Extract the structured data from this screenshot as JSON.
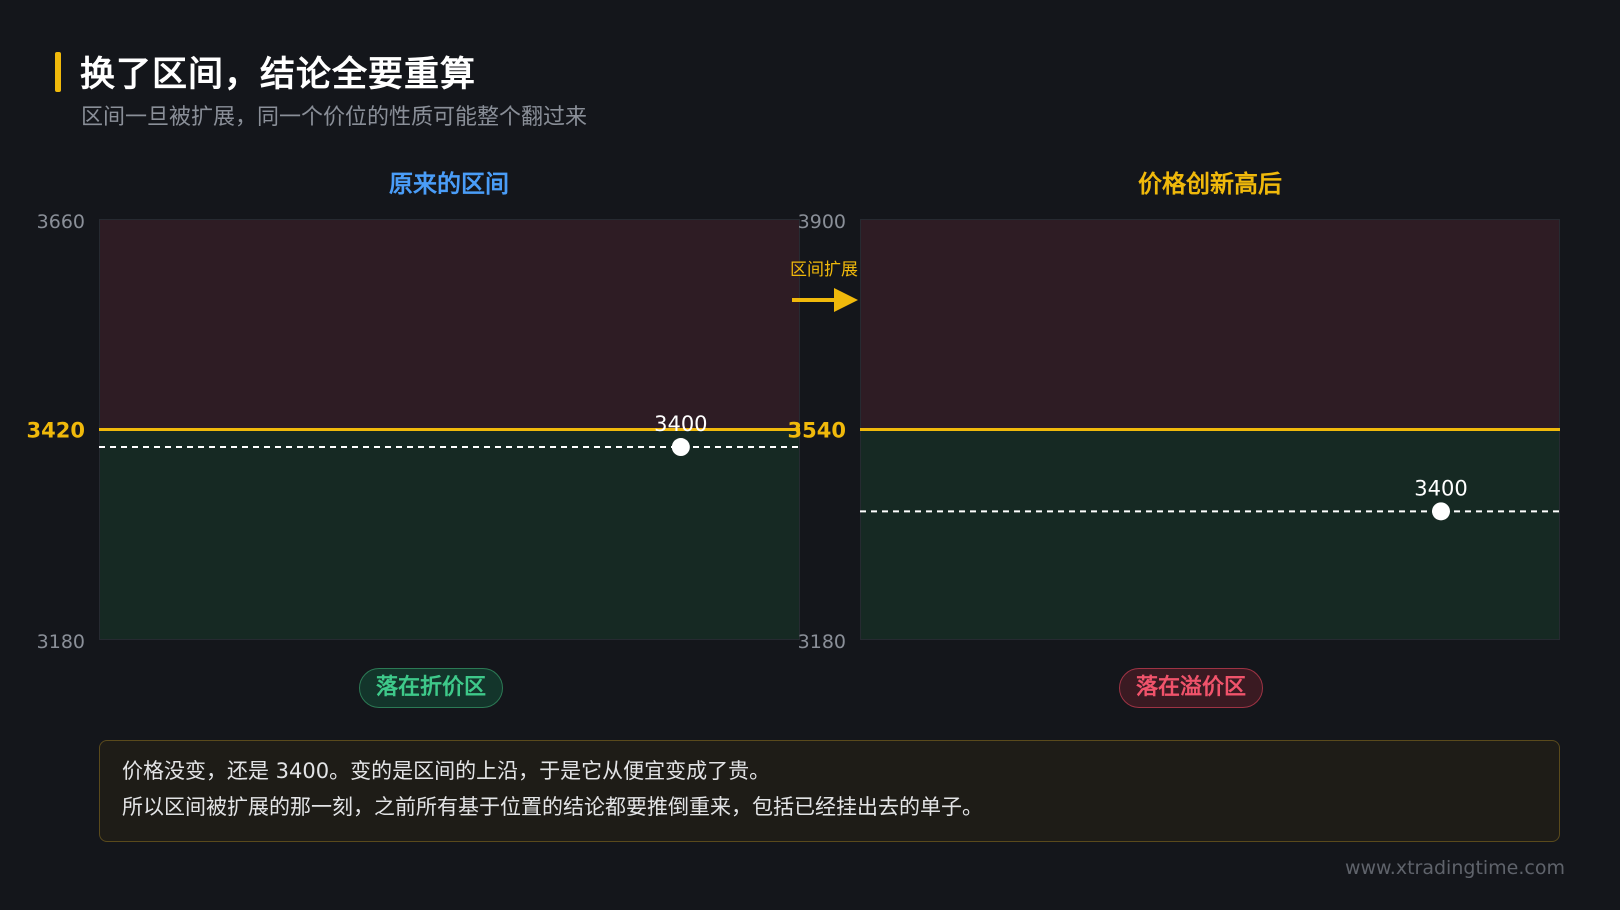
{
  "header": {
    "title": "换了区间，结论全要重算",
    "subtitle": "区间一旦被扩展，同一个价位的性质可能整个翻过来"
  },
  "colors": {
    "accent": "#f0b90b",
    "premium_zone": "#2e1c24",
    "discount_zone": "#162923",
    "blue_title": "#4a9df8",
    "green": "#3ec98a",
    "red": "#f0536b"
  },
  "arrow_label": "区间扩展",
  "panels": [
    {
      "title": "原来的区间",
      "title_color": "#4a9df8",
      "badge": "落在折价区",
      "range": [
        3180,
        3660
      ],
      "ticks": [
        "3660",
        "3420",
        "3180"
      ],
      "equilibrium": 3420,
      "price": 3400,
      "price_label": "3400",
      "price_x_fraction": 0.83
    },
    {
      "title": "价格创新高后",
      "title_color": "#f0b90b",
      "badge": "落在溢价区",
      "range": [
        3180,
        3900
      ],
      "ticks": [
        "3900",
        "3540",
        "3180"
      ],
      "equilibrium": 3540,
      "price": 3400,
      "price_label": "3400",
      "price_x_fraction": 0.83
    }
  ],
  "note": {
    "line1": "价格没变，还是 3400。变的是区间的上沿，于是它从便宜变成了贵。",
    "line2": "所以区间被扩展的那一刻，之前所有基于位置的结论都要推倒重来，包括已经挂出去的单子。"
  },
  "footer": "www.xtradingtime.com"
}
